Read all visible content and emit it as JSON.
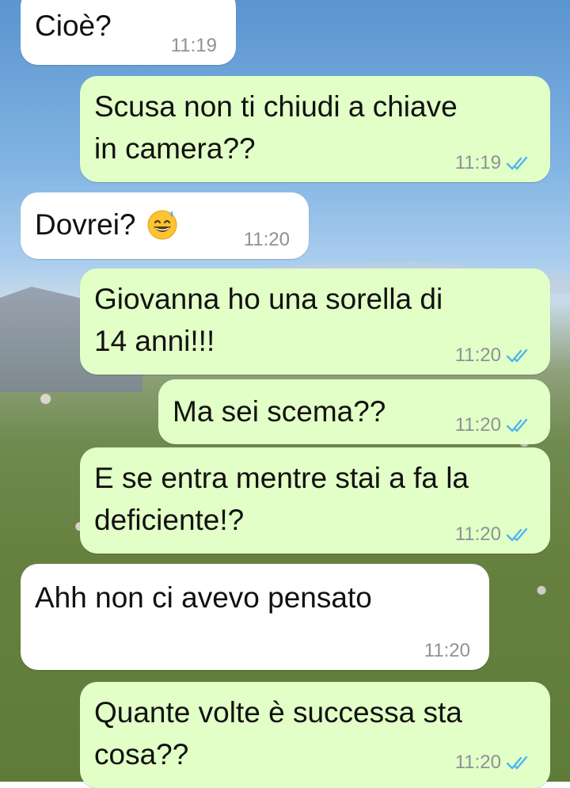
{
  "messages": [
    {
      "text": "Cioè?",
      "time": "11:19",
      "direction": "in"
    },
    {
      "line1": "Scusa non ti chiudi a chiave",
      "line2": "in camera??",
      "time": "11:19",
      "direction": "out",
      "status": "read"
    },
    {
      "text": "Dovrei?",
      "emoji": "grinning-sweat-emoji",
      "time": "11:20",
      "direction": "in"
    },
    {
      "line1": "Giovanna ho una sorella di",
      "line2": "14 anni!!!",
      "time": "11:20",
      "direction": "out",
      "status": "read"
    },
    {
      "text": "Ma sei scema??",
      "time": "11:20",
      "direction": "out",
      "status": "read"
    },
    {
      "line1": "E se entra mentre stai a fa la",
      "line2": "deficiente!?",
      "time": "11:20",
      "direction": "out",
      "status": "read"
    },
    {
      "text": "Ahh non ci avevo pensato",
      "time": "11:20",
      "direction": "in"
    },
    {
      "line1": "Quante volte è successa sta",
      "line2": "cosa??",
      "time": "11:20",
      "direction": "out",
      "status": "read"
    }
  ],
  "colors": {
    "incoming_bubble": "#ffffff",
    "outgoing_bubble": "#e2ffc7",
    "read_tick": "#4fb6ec",
    "timestamp": "#8d9295"
  }
}
